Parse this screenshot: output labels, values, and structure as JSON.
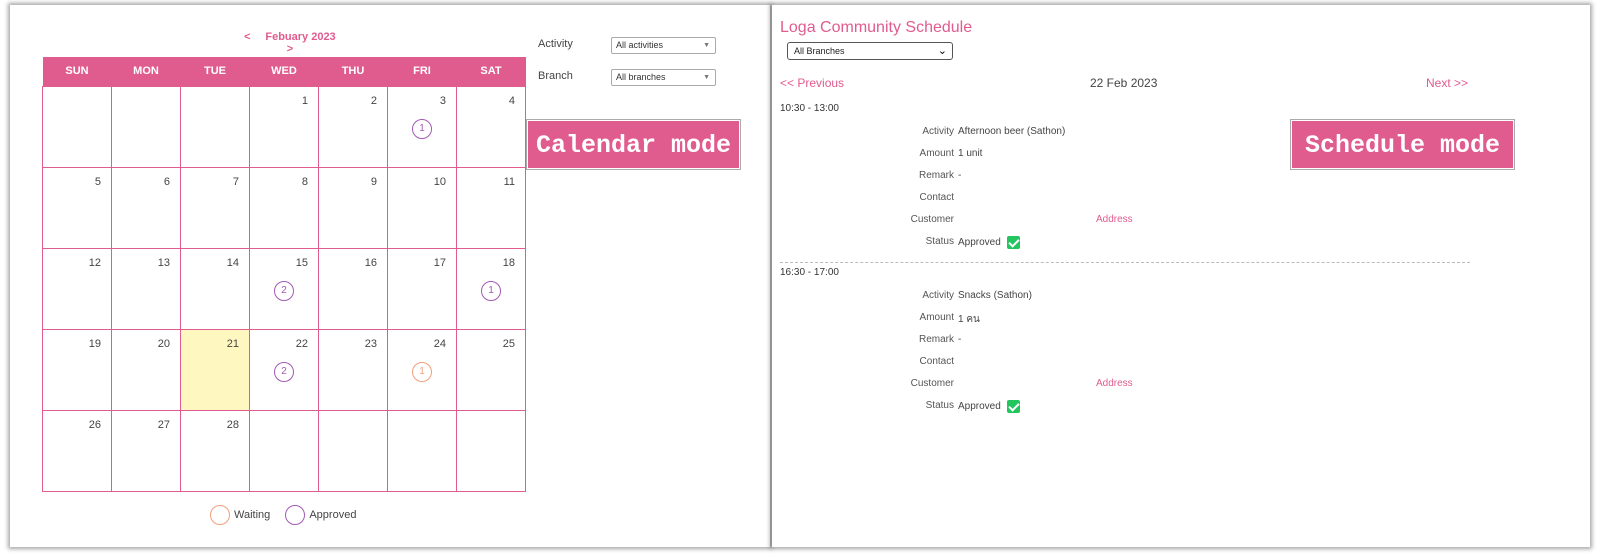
{
  "calendar": {
    "prev": "<",
    "next": ">",
    "month": "Febuary 2023",
    "weekdays": [
      "SUN",
      "MON",
      "TUE",
      "WED",
      "THU",
      "FRI",
      "SAT"
    ],
    "weeks": [
      [
        {
          "d": ""
        },
        {
          "d": ""
        },
        {
          "d": ""
        },
        {
          "d": "1"
        },
        {
          "d": "2"
        },
        {
          "d": "3",
          "count": "1",
          "status": "approved"
        },
        {
          "d": "4"
        }
      ],
      [
        {
          "d": "5"
        },
        {
          "d": "6"
        },
        {
          "d": "7"
        },
        {
          "d": "8"
        },
        {
          "d": "9"
        },
        {
          "d": "10"
        },
        {
          "d": "11"
        }
      ],
      [
        {
          "d": "12"
        },
        {
          "d": "13"
        },
        {
          "d": "14"
        },
        {
          "d": "15",
          "count": "2",
          "status": "approved"
        },
        {
          "d": "16"
        },
        {
          "d": "17"
        },
        {
          "d": "18",
          "count": "1",
          "status": "approved"
        }
      ],
      [
        {
          "d": "19"
        },
        {
          "d": "20"
        },
        {
          "d": "21",
          "today": true
        },
        {
          "d": "22",
          "count": "2",
          "status": "approved"
        },
        {
          "d": "23"
        },
        {
          "d": "24",
          "count": "1",
          "status": "waiting"
        },
        {
          "d": "25"
        }
      ],
      [
        {
          "d": "26"
        },
        {
          "d": "27"
        },
        {
          "d": "28"
        },
        {
          "d": ""
        },
        {
          "d": ""
        },
        {
          "d": ""
        },
        {
          "d": ""
        }
      ]
    ],
    "legend": {
      "waiting": "Waiting",
      "approved": "Approved"
    },
    "colors": {
      "accent": "#e05c8e",
      "approved": "#a35ab5",
      "waiting": "#f0a07c",
      "today": "#fff7c0"
    }
  },
  "filters": {
    "activity_label": "Activity",
    "activity_value": "All activities",
    "branch_label": "Branch",
    "branch_value": "All branches"
  },
  "modes": {
    "calendar": "Calendar mode",
    "schedule": "Schedule mode"
  },
  "schedule": {
    "title": "Loga Community Schedule",
    "branch_value": "All Branches",
    "prev": "<< Previous",
    "next": "Next >>",
    "date": "22 Feb 2023",
    "labels": {
      "activity": "Activity",
      "amount": "Amount",
      "remark": "Remark",
      "contact": "Contact",
      "customer": "Customer",
      "status": "Status"
    },
    "address_link": "Address",
    "slots": [
      {
        "time": "10:30 - 13:00",
        "activity": "Afternoon beer (Sathon)",
        "amount": "1 unit",
        "remark": "-",
        "contact": "",
        "customer": "",
        "status": "Approved"
      },
      {
        "time": "16:30 - 17:00",
        "activity": "Snacks (Sathon)",
        "amount": "1 คน",
        "remark": "-",
        "contact": "",
        "customer": "",
        "status": "Approved"
      }
    ]
  }
}
